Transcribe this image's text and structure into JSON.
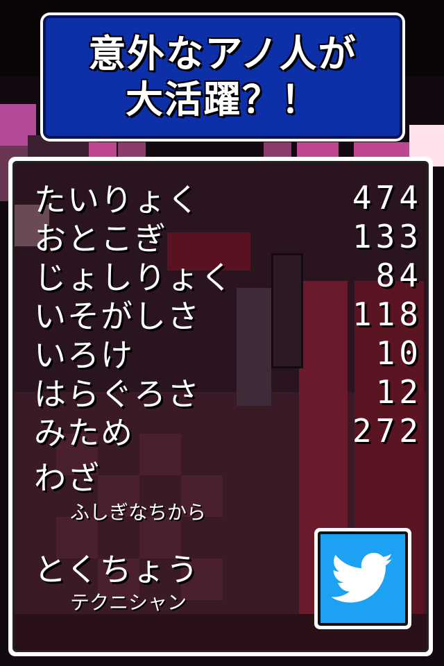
{
  "banner": {
    "line1": "意外なアノ人が",
    "line2": "大活躍？！"
  },
  "stats": [
    {
      "label": "たいりょく",
      "value": "474"
    },
    {
      "label": "おとこぎ",
      "value": "133"
    },
    {
      "label": "じょしりょく",
      "value": "84"
    },
    {
      "label": "いそがしさ",
      "value": "118"
    },
    {
      "label": "いろけ",
      "value": "10"
    },
    {
      "label": "はらぐろさ",
      "value": "12"
    },
    {
      "label": "みため",
      "value": "272"
    }
  ],
  "skill": {
    "label": "わざ",
    "value": "ふしぎなちから"
  },
  "trait": {
    "label": "とくちょう",
    "value": "テクニシャン"
  },
  "share": {
    "icon": "twitter-bird-icon",
    "color": "#1da1f2"
  },
  "colors": {
    "banner_bg": "#0d2fa8",
    "panel_border": "#ffffff"
  }
}
